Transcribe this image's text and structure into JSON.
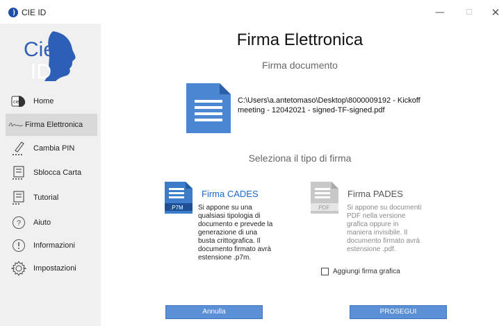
{
  "window": {
    "title": "CIE ID",
    "minimize": "—",
    "maximize": "☐",
    "close": "✕"
  },
  "logo": {
    "line1": "Cie",
    "line2": "ID"
  },
  "sidebar": {
    "items": [
      {
        "label": "Home",
        "icon": "home-cie-icon"
      },
      {
        "label": "Firma Elettronica",
        "icon": "signature-icon",
        "active": true
      },
      {
        "label": "Cambia PIN",
        "icon": "pen-pin-icon"
      },
      {
        "label": "Sblocca Carta",
        "icon": "card-unlock-icon"
      },
      {
        "label": "Tutorial",
        "icon": "tutorial-icon"
      },
      {
        "label": "Aiuto",
        "icon": "help-icon"
      },
      {
        "label": "Informazioni",
        "icon": "info-icon"
      },
      {
        "label": "Impostazioni",
        "icon": "settings-gear-icon"
      }
    ]
  },
  "main": {
    "title": "Firma Elettronica",
    "subtitle": "Firma documento",
    "document_path": "C:\\Users\\a.antetomaso\\Desktop\\8000009192 - Kickoff meeting - 12042021 - signed-TF-signed.pdf",
    "select_title": "Seleziona il tipo di firma",
    "cades": {
      "icon_label": ".P7M",
      "title": "Firma CADES",
      "description": "Si appone su una qualsiasi tipologia di documento e prevede la generazione di una busta crittografica. Il documento firmato avrà estensione .p7m."
    },
    "pades": {
      "icon_label": ".PDF",
      "title": "Firma PADES",
      "description": "Si appone su documenti PDF nella versione grafica oppure in maniera invisibile. Il documento firmato avrà estensione .pdf."
    },
    "checkbox_label": "Aggiungi firma grafica",
    "checkbox_checked": false,
    "cancel_label": "Annulla",
    "next_label": "PROSEGUI"
  },
  "colors": {
    "accent": "#1b66c9",
    "button": "#5b8fd6",
    "sidebar_bg": "#f0f0f0",
    "sidebar_active": "#d9d9d9",
    "doc_icon": "#4a86d1"
  }
}
